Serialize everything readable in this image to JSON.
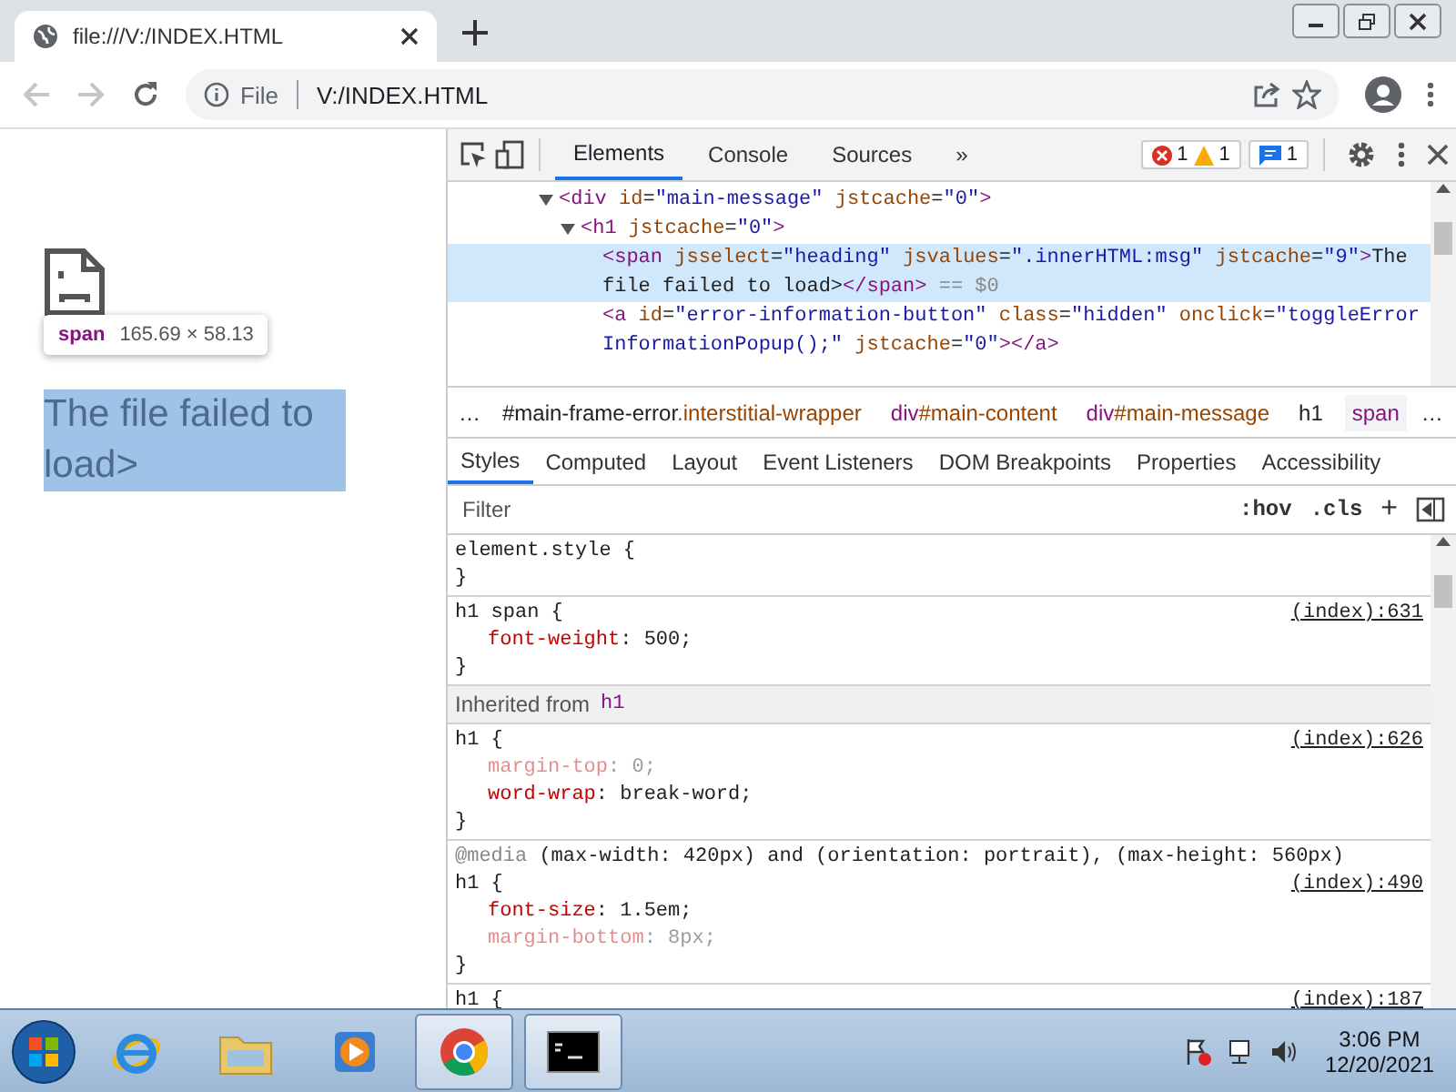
{
  "browser": {
    "tab": {
      "title": "file:///V:/INDEX.HTML"
    },
    "back_disabled": true,
    "forward_disabled": true,
    "address": {
      "scheme": "File",
      "url": "V:/INDEX.HTML"
    }
  },
  "page": {
    "tooltip": {
      "tag": "span",
      "size": "165.69 × 58.13"
    },
    "heading": "The file failed to load>"
  },
  "devtools": {
    "tabs": [
      {
        "label": "Elements",
        "selected": true
      },
      {
        "label": "Console",
        "selected": false
      },
      {
        "label": "Sources",
        "selected": false
      }
    ],
    "more": "»",
    "counts": [
      {
        "kind": "error",
        "count": "1"
      },
      {
        "kind": "warning",
        "count": "1"
      },
      {
        "kind": "message",
        "count": "1"
      }
    ],
    "dom": [
      {
        "expanded": true,
        "selected": false,
        "lines": [
          [
            {
              "kind": "tag",
              "text": "<div"
            },
            {
              "kind": "attr",
              "text": " id"
            },
            {
              "kind": "text",
              "text": "="
            },
            {
              "kind": "val",
              "text": "\"main-message\""
            },
            {
              "kind": "attr",
              "text": " jstcache"
            },
            {
              "kind": "text",
              "text": "="
            },
            {
              "kind": "val",
              "text": "\"0\""
            },
            {
              "kind": "tag",
              "text": ">"
            }
          ]
        ],
        "children": [
          {
            "expanded": true,
            "selected": false,
            "lines": [
              [
                {
                  "kind": "tag",
                  "text": "<h1"
                },
                {
                  "kind": "attr",
                  "text": " jstcache"
                },
                {
                  "kind": "text",
                  "text": "="
                },
                {
                  "kind": "val",
                  "text": "\"0\""
                },
                {
                  "kind": "tag",
                  "text": ">"
                }
              ]
            ],
            "children": [
              {
                "selected": true,
                "lines": [
                  [
                    {
                      "kind": "tag",
                      "text": "<span"
                    },
                    {
                      "kind": "attr",
                      "text": " jsselect"
                    },
                    {
                      "kind": "text",
                      "text": "="
                    },
                    {
                      "kind": "val",
                      "text": "\"heading\""
                    },
                    {
                      "kind": "attr",
                      "text": " jsvalues"
                    },
                    {
                      "kind": "text",
                      "text": "="
                    },
                    {
                      "kind": "val",
                      "text": "\".innerHTML:msg\""
                    },
                    {
                      "kind": "attr",
                      "text": " jstcache"
                    },
                    {
                      "kind": "text",
                      "text": "="
                    },
                    {
                      "kind": "val",
                      "text": "\"9\""
                    },
                    {
                      "kind": "tag",
                      "text": ">"
                    },
                    {
                      "kind": "text",
                      "text": "The"
                    }
                  ],
                  [
                    {
                      "kind": "text",
                      "text": "file failed to load>"
                    },
                    {
                      "kind": "tag",
                      "text": "</span>"
                    },
                    {
                      "kind": "dim",
                      "text": " == $0"
                    }
                  ]
                ]
              },
              {
                "selected": false,
                "lines": [
                  [
                    {
                      "kind": "tag",
                      "text": "<a"
                    },
                    {
                      "kind": "attr",
                      "text": " id"
                    },
                    {
                      "kind": "text",
                      "text": "="
                    },
                    {
                      "kind": "val",
                      "text": "\"error-information-button\""
                    },
                    {
                      "kind": "attr",
                      "text": " class"
                    },
                    {
                      "kind": "text",
                      "text": "="
                    },
                    {
                      "kind": "val",
                      "text": "\"hidden\""
                    },
                    {
                      "kind": "attr",
                      "text": " onclick"
                    },
                    {
                      "kind": "text",
                      "text": "="
                    },
                    {
                      "kind": "val",
                      "text": "\"toggleError"
                    }
                  ],
                  [
                    {
                      "kind": "val",
                      "text": "InformationPopup();\""
                    },
                    {
                      "kind": "attr",
                      "text": " jstcache"
                    },
                    {
                      "kind": "text",
                      "text": "="
                    },
                    {
                      "kind": "val",
                      "text": "\"0\""
                    },
                    {
                      "kind": "tag",
                      "text": ">"
                    },
                    {
                      "kind": "tag",
                      "text": "</a>"
                    }
                  ]
                ]
              }
            ]
          }
        ]
      }
    ],
    "breadcrumbs": {
      "before": "…",
      "after": "…",
      "items": [
        {
          "selected": false,
          "parts": [
            {
              "kind": "id",
              "text": "#main-frame-error"
            },
            {
              "kind": "class",
              "text": ".interstitial-wrapper"
            }
          ]
        },
        {
          "selected": false,
          "parts": [
            {
              "kind": "tag",
              "text": "div"
            },
            {
              "kind": "class",
              "text": "#main-content"
            }
          ]
        },
        {
          "selected": false,
          "parts": [
            {
              "kind": "tag",
              "text": "div"
            },
            {
              "kind": "class",
              "text": "#main-message"
            }
          ]
        },
        {
          "selected": false,
          "parts": [
            {
              "kind": "id",
              "text": "h1"
            }
          ]
        },
        {
          "selected": true,
          "parts": [
            {
              "kind": "tag",
              "text": "span"
            }
          ]
        }
      ]
    },
    "style_tabs": [
      {
        "label": "Styles",
        "selected": true
      },
      {
        "label": "Computed",
        "selected": false
      },
      {
        "label": "Layout",
        "selected": false
      },
      {
        "label": "Event Listeners",
        "selected": false
      },
      {
        "label": "DOM Breakpoints",
        "selected": false
      },
      {
        "label": "Properties",
        "selected": false
      },
      {
        "label": "Accessibility",
        "selected": false
      }
    ],
    "filter": {
      "placeholder": "Filter",
      "hov": ":hov",
      "cls": ".cls",
      "add": "+"
    },
    "rules": [
      {
        "kind": "rule",
        "selector": "element.style {",
        "close": "}"
      },
      {
        "kind": "rule",
        "selector": "h1 span {",
        "source": "(index):631",
        "decls": [
          {
            "text": "font-weight: 500;",
            "overridden": false
          }
        ],
        "close": "}"
      },
      {
        "kind": "inherited",
        "label": "Inherited from",
        "tag": "h1"
      },
      {
        "kind": "rule",
        "selector": "h1 {",
        "source": "(index):626",
        "decls": [
          {
            "text": "margin-top: 0;",
            "overridden": true
          },
          {
            "text": "word-wrap: break-word;",
            "overridden": false
          }
        ],
        "close": "}"
      },
      {
        "kind": "rule",
        "media_at": "@media",
        "media": " (max-width: 420px) and (orientation: portrait), (max-height: 560px)",
        "selector": "h1 {",
        "source": "(index):490",
        "decls": [
          {
            "text": "font-size: 1.5em;",
            "overridden": false
          },
          {
            "text": "margin-bottom: 8px;",
            "overridden": true
          }
        ],
        "close": "}"
      },
      {
        "kind": "rule",
        "selector": "h1 {",
        "source": "(index):187"
      }
    ]
  },
  "taskbar": {
    "apps": [
      {
        "kind": "ie",
        "running": false
      },
      {
        "kind": "explorer",
        "running": false
      },
      {
        "kind": "media",
        "running": false
      },
      {
        "kind": "chrome",
        "running": true
      },
      {
        "kind": "cmd",
        "running": true
      }
    ],
    "time": "3:06 PM",
    "date": "12/20/2021"
  }
}
